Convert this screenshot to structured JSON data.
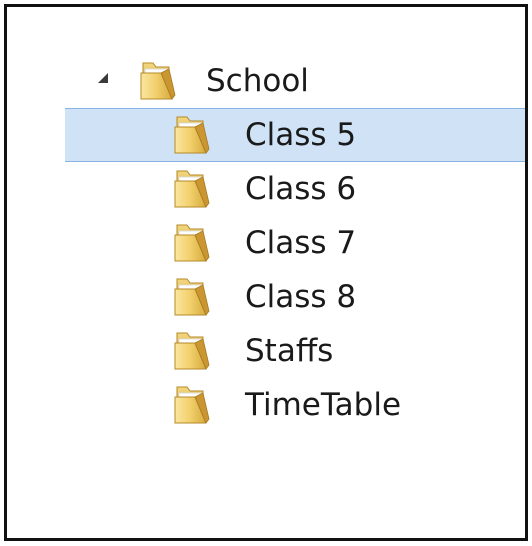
{
  "tree": {
    "root": {
      "label": "School",
      "icon": "folder-icon",
      "expanded": true
    },
    "children": [
      {
        "label": "Class 5",
        "icon": "folder-icon",
        "selected": true
      },
      {
        "label": "Class 6",
        "icon": "folder-icon",
        "selected": false
      },
      {
        "label": "Class 7",
        "icon": "folder-icon",
        "selected": false
      },
      {
        "label": "Class 8",
        "icon": "folder-icon",
        "selected": false
      },
      {
        "label": "Staffs",
        "icon": "folder-icon",
        "selected": false
      },
      {
        "label": "TimeTable",
        "icon": "folder-icon",
        "selected": false
      }
    ]
  },
  "colors": {
    "selection_fill": "#cfe2f6",
    "selection_border": "#88b3e3",
    "folder": "#e8c25a",
    "text": "#1a1a1a"
  }
}
